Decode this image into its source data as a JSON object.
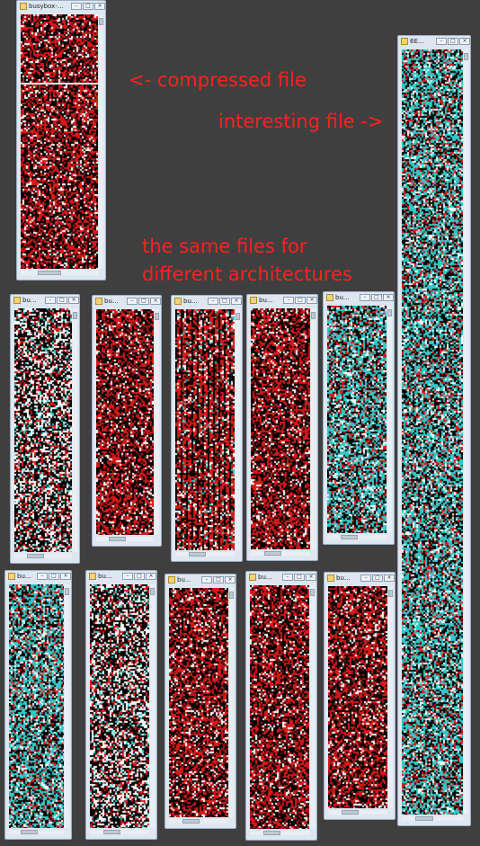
{
  "annotations": {
    "compressed": "<- compressed file",
    "interesting": "interesting file ->",
    "same_line1": "the same files for",
    "same_line2": "different architectures"
  },
  "windows": [
    {
      "title": "busybox-...",
      "palette": "red"
    },
    {
      "title": "6E...",
      "palette": "cyan"
    },
    {
      "title": "bu...",
      "palette": "mono"
    },
    {
      "title": "bu...",
      "palette": "red"
    },
    {
      "title": "bu...",
      "palette": "redstripe"
    },
    {
      "title": "bu...",
      "palette": "red"
    },
    {
      "title": "bu...",
      "palette": "cyan"
    },
    {
      "title": "bu...",
      "palette": "cyan"
    },
    {
      "title": "bu...",
      "palette": "mono"
    },
    {
      "title": "bu...",
      "palette": "red"
    },
    {
      "title": "bu...",
      "palette": "red"
    },
    {
      "title": "bu...",
      "palette": "red"
    }
  ],
  "titlebar": {
    "minimize": "–",
    "maximize": "□",
    "close": "×"
  },
  "colors": {
    "background": "#3f3f3f",
    "annotation": "#ff2020",
    "window_frame": "#dde7f1"
  }
}
